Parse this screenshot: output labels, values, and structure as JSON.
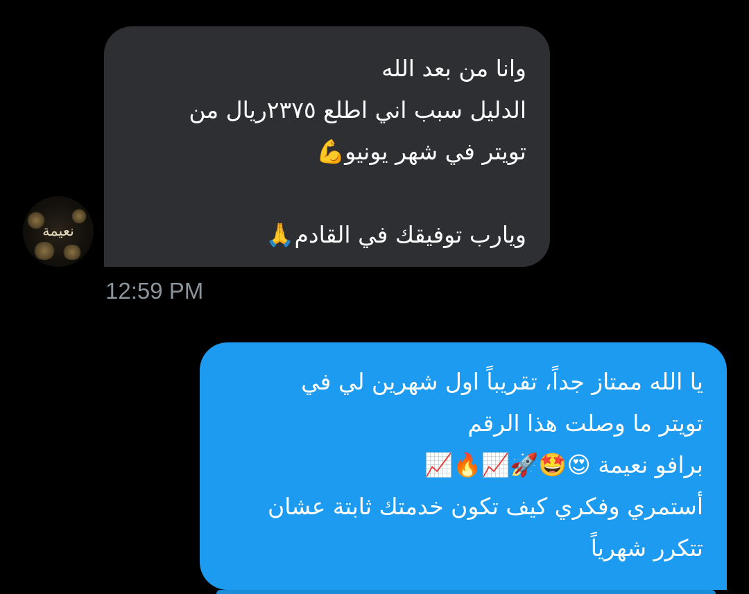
{
  "incoming": {
    "sender_avatar_text": "نعيمة",
    "lines": [
      "وانا من بعد الله",
      "الدليل سبب اني اطلع ٢٣٧٥ريال من",
      "تويتر في شهر يونيو💪",
      "",
      "ويارب توفيقك في القادم🙏"
    ],
    "timestamp": "12:59 PM"
  },
  "outgoing": {
    "lines": [
      "يا الله ممتاز جداً، تقريباً اول شهرين لي في",
      "تويتر ما وصلت هذا الرقم",
      "برافو نعيمة 😍🤩🚀📈🔥📈",
      "أستمري وفكري كيف تكون خدمتك ثابتة عشان",
      "تتكرر شهرياً"
    ]
  },
  "colors": {
    "background": "#000000",
    "incoming_bubble": "#2d2f33",
    "outgoing_bubble": "#1d9bf0",
    "timestamp_text": "#8b949b",
    "message_text": "#ffffff"
  }
}
